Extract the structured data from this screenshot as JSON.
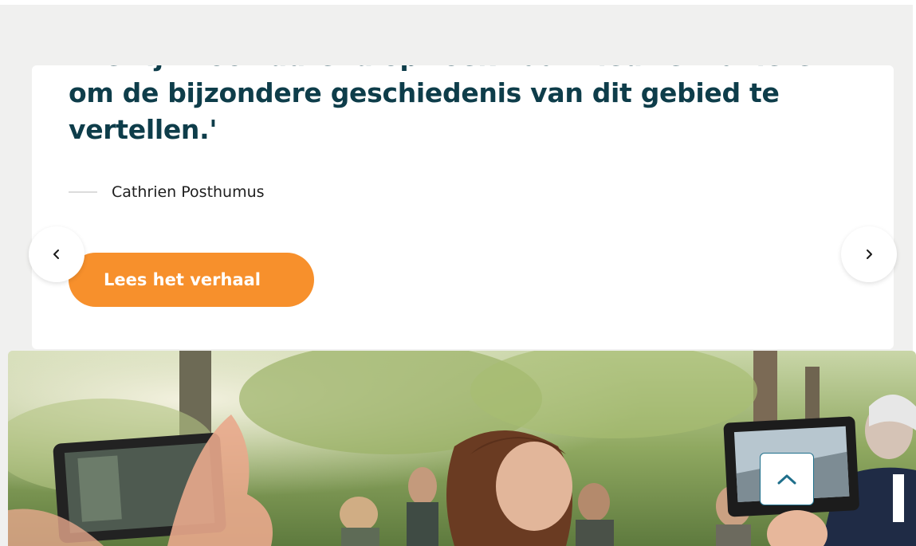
{
  "quote": {
    "text": "'We zijn voortdurend op zoek naar nieuwe manieren om de bijzondere geschiedenis van dit gebied te vertellen.'",
    "author": "Cathrien Posthumus"
  },
  "cta": {
    "label": "Lees het verhaal"
  },
  "carousel": {
    "prev_icon": "chevron-left-icon",
    "next_icon": "chevron-right-icon"
  },
  "photo": {
    "description_icon": "photo"
  },
  "scroll_top": {
    "icon": "chevron-up-icon"
  },
  "colors": {
    "background": "#f0f0ef",
    "quote_text": "#0e3d4a",
    "cta": "#f7902c",
    "scroll_top_border": "#1f6f8b"
  }
}
